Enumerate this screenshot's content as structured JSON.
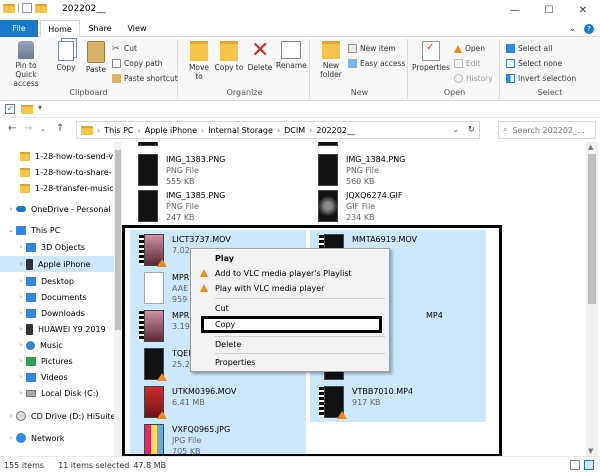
{
  "window": {
    "title": "202202__",
    "controls": {
      "minimize": "—",
      "maximize": "☐",
      "close": "✕"
    }
  },
  "tabs": {
    "file": "File",
    "home": "Home",
    "share": "Share",
    "view": "View",
    "expand": "⌄",
    "help": "?"
  },
  "ribbon": {
    "clipboard": {
      "label": "Clipboard",
      "pin": "Pin to Quick access",
      "copy": "Copy",
      "paste": "Paste",
      "cut": "Cut",
      "copy_path": "Copy path",
      "paste_shortcut": "Paste shortcut"
    },
    "organize": {
      "label": "Organize",
      "move_to": "Move to",
      "copy_to": "Copy to",
      "delete": "Delete",
      "rename": "Rename"
    },
    "new": {
      "label": "New",
      "new_folder": "New folder",
      "new_item": "New item",
      "easy_access": "Easy access"
    },
    "open": {
      "label": "Open",
      "properties": "Properties",
      "open": "Open",
      "edit": "Edit",
      "history": "History"
    },
    "select": {
      "label": "Select",
      "select_all": "Select all",
      "select_none": "Select none",
      "invert": "Invert selection"
    }
  },
  "address": {
    "crumbs": [
      "This PC",
      "Apple iPhone",
      "Internal Storage",
      "DCIM",
      "202202__"
    ],
    "search_placeholder": "Search 202202_..."
  },
  "sidebar": {
    "items": [
      {
        "label": "1-28-how-to-send-v"
      },
      {
        "label": "1-28-how-to-share-"
      },
      {
        "label": "1-28-transfer-music"
      },
      {
        "label": "OneDrive - Personal"
      },
      {
        "label": "This PC"
      },
      {
        "label": "3D Objects"
      },
      {
        "label": "Apple iPhone"
      },
      {
        "label": "Desktop"
      },
      {
        "label": "Documents"
      },
      {
        "label": "Downloads"
      },
      {
        "label": "HUAWEI Y9 2019"
      },
      {
        "label": "Music"
      },
      {
        "label": "Pictures"
      },
      {
        "label": "Videos"
      },
      {
        "label": "Local Disk (C:)"
      },
      {
        "label": "CD Drive (D:) HiSuite"
      },
      {
        "label": "Network"
      }
    ]
  },
  "files": [
    {
      "name": "",
      "type": "",
      "size": ""
    },
    {
      "name": "",
      "type": "",
      "size": ""
    },
    {
      "name": "IMG_1383.PNG",
      "type": "PNG File",
      "size": "555 KB"
    },
    {
      "name": "IMG_1384.PNG",
      "type": "PNG File",
      "size": "560 KB"
    },
    {
      "name": "IMG_1385.PNG",
      "type": "PNG File",
      "size": "247 KB"
    },
    {
      "name": "JQXQ6274.GIF",
      "type": "GIF File",
      "size": "234 KB"
    },
    {
      "name": "LICT3737.MOV",
      "type": "",
      "size": "7.02"
    },
    {
      "name": "MMTA6919.MOV",
      "type": "",
      "size": ""
    },
    {
      "name": "MPR",
      "type": "AAE",
      "size": "959 B"
    },
    {
      "name": "",
      "type": "",
      "size": ""
    },
    {
      "name": "MPR",
      "type": "",
      "size": "3.19"
    },
    {
      "name": "MP4",
      "type": "",
      "size": ""
    },
    {
      "name": "TQEN",
      "type": "",
      "size": "25.2"
    },
    {
      "name": "",
      "type": "",
      "size": ""
    },
    {
      "name": "UTKM0396.MOV",
      "type": "",
      "size": "6.41 MB"
    },
    {
      "name": "VTBB7010.MP4",
      "type": "",
      "size": "917 KB"
    },
    {
      "name": "VXFQ0965.JPG",
      "type": "JPG File",
      "size": "705 KB"
    }
  ],
  "context_menu": {
    "play": "Play",
    "add_playlist": "Add to VLC media player's Playlist",
    "play_vlc": "Play with VLC media player",
    "cut": "Cut",
    "copy": "Copy",
    "delete": "Delete",
    "properties": "Properties"
  },
  "status": {
    "count": "155 items",
    "selected": "11 items selected",
    "size": "47.8 MB"
  },
  "colors": {
    "accent": "#1979ca",
    "selection": "#cce8ff",
    "vlc_orange": "#f08a1c"
  }
}
